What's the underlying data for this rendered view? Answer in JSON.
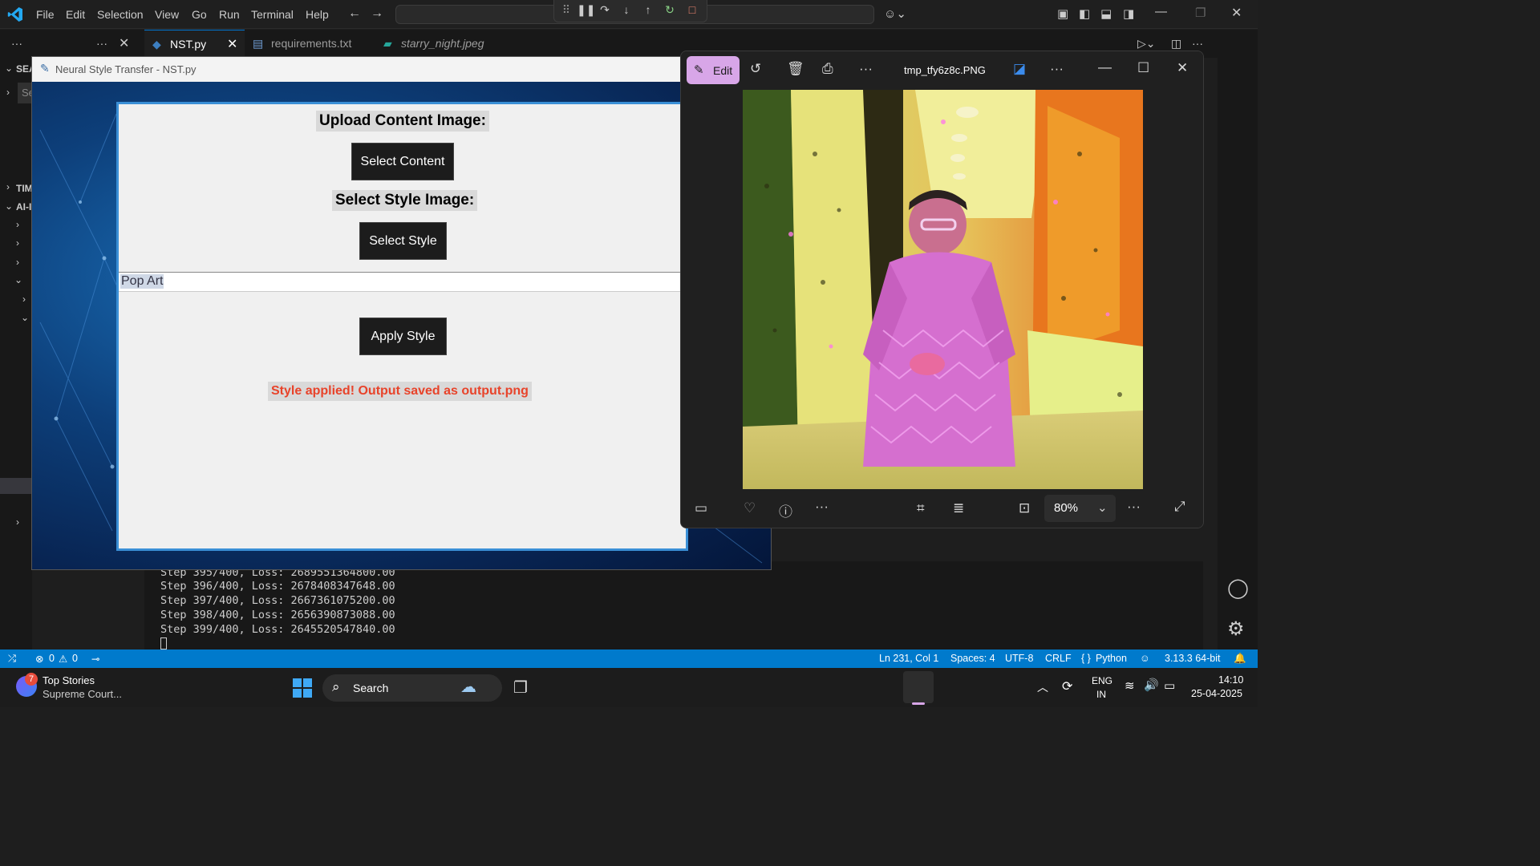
{
  "menu": [
    "File",
    "Edit",
    "Selection",
    "View",
    "Go",
    "Run",
    "Terminal",
    "Help"
  ],
  "tabs": [
    {
      "label": "NST.py",
      "icon": "python-icon"
    },
    {
      "label": "requirements.txt",
      "icon": "text-file-icon"
    },
    {
      "label": "starry_night.jpeg",
      "icon": "image-file-icon"
    }
  ],
  "sidebar": {
    "sections": [
      "SEA",
      "TIM",
      "AI-I"
    ],
    "search_placeholder": "Se"
  },
  "tk_window": {
    "title": "Neural Style Transfer - NST.py",
    "upload_label": "Upload Content Image:",
    "select_content_button": "Select Content",
    "style_label": "Select Style Image:",
    "select_style_button": "Select Style",
    "style_combo_value": "Pop Art",
    "apply_button": "Apply Style",
    "status_message": "Style applied! Output saved as output.png"
  },
  "terminal": {
    "lines": [
      "Step 395/400, Loss: 2689551364800.00",
      "Step 396/400, Loss: 2678408347648.00",
      "Step 397/400, Loss: 2667361075200.00",
      "Step 398/400, Loss: 2656390873088.00",
      "Step 399/400, Loss: 2645520547840.00"
    ]
  },
  "photos": {
    "edit_label": "Edit",
    "filename": "tmp_tfy6z8c.PNG",
    "zoom": "80%"
  },
  "statusbar": {
    "errors": "0",
    "warnings": "0",
    "position": "Ln 231, Col 1",
    "spaces": "Spaces: 4",
    "encoding": "UTF-8",
    "eol": "CRLF",
    "language": "Python",
    "interpreter": "3.13.3 64-bit"
  },
  "taskbar": {
    "news_badge": "7",
    "news_title": "Top Stories",
    "news_subtitle": "Supreme Court...",
    "search_label": "Search",
    "lang_primary": "ENG",
    "lang_secondary": "IN",
    "time": "14:10",
    "date": "25-04-2025"
  },
  "colors": {
    "statusbar": "#007acc",
    "accent_tab": "#0078d4",
    "edit_button": "#d8a6e8",
    "status_message": "#e8432a"
  }
}
